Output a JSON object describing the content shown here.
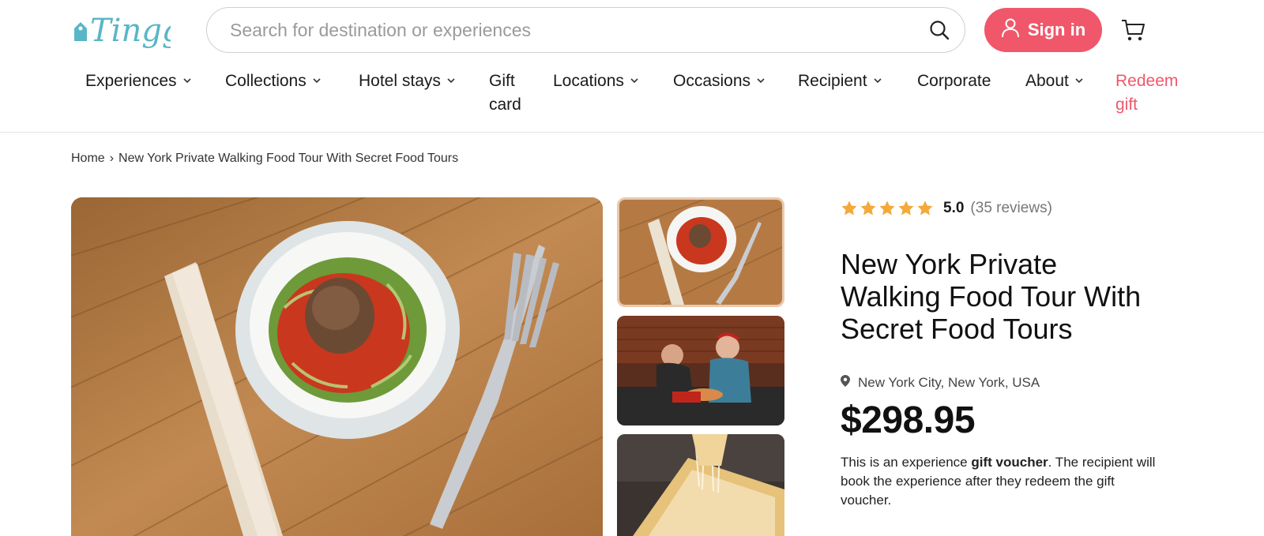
{
  "header": {
    "logo_text": "Tinggly",
    "search_placeholder": "Search for destination or experiences",
    "signin_label": "Sign in",
    "brand_color": "#f0576a"
  },
  "nav": {
    "experiences": "Experiences",
    "collections": "Collections",
    "hotel_stays": "Hotel stays",
    "gift_card_line1": "Gift",
    "gift_card_line2": "card",
    "locations": "Locations",
    "occasions": "Occasions",
    "recipient": "Recipient",
    "corporate": "Corporate",
    "about": "About",
    "redeem_line1": "Redeem",
    "redeem_line2": "gift"
  },
  "breadcrumb": {
    "home": "Home",
    "separator": "›",
    "current": "New York Private Walking Food Tour With Secret Food Tours"
  },
  "product": {
    "rating_value": "5.0",
    "rating_count": "(35 reviews)",
    "stars": 5,
    "title": "New York Private Walking Food Tour With Secret Food Tours",
    "location": "New York City, New York, USA",
    "price": "$298.95",
    "desc_before": "This is an experience ",
    "desc_bold": "gift voucher",
    "desc_after": ". The recipient will book the experience after they redeem the gift voucher."
  },
  "icons": {
    "search": "search-icon",
    "user": "user-icon",
    "cart": "cart-icon",
    "star": "star-icon",
    "pin": "location-pin-icon",
    "chevron": "chevron-down-icon"
  },
  "colors": {
    "accent": "#f0576a",
    "star": "#f4a93b"
  }
}
